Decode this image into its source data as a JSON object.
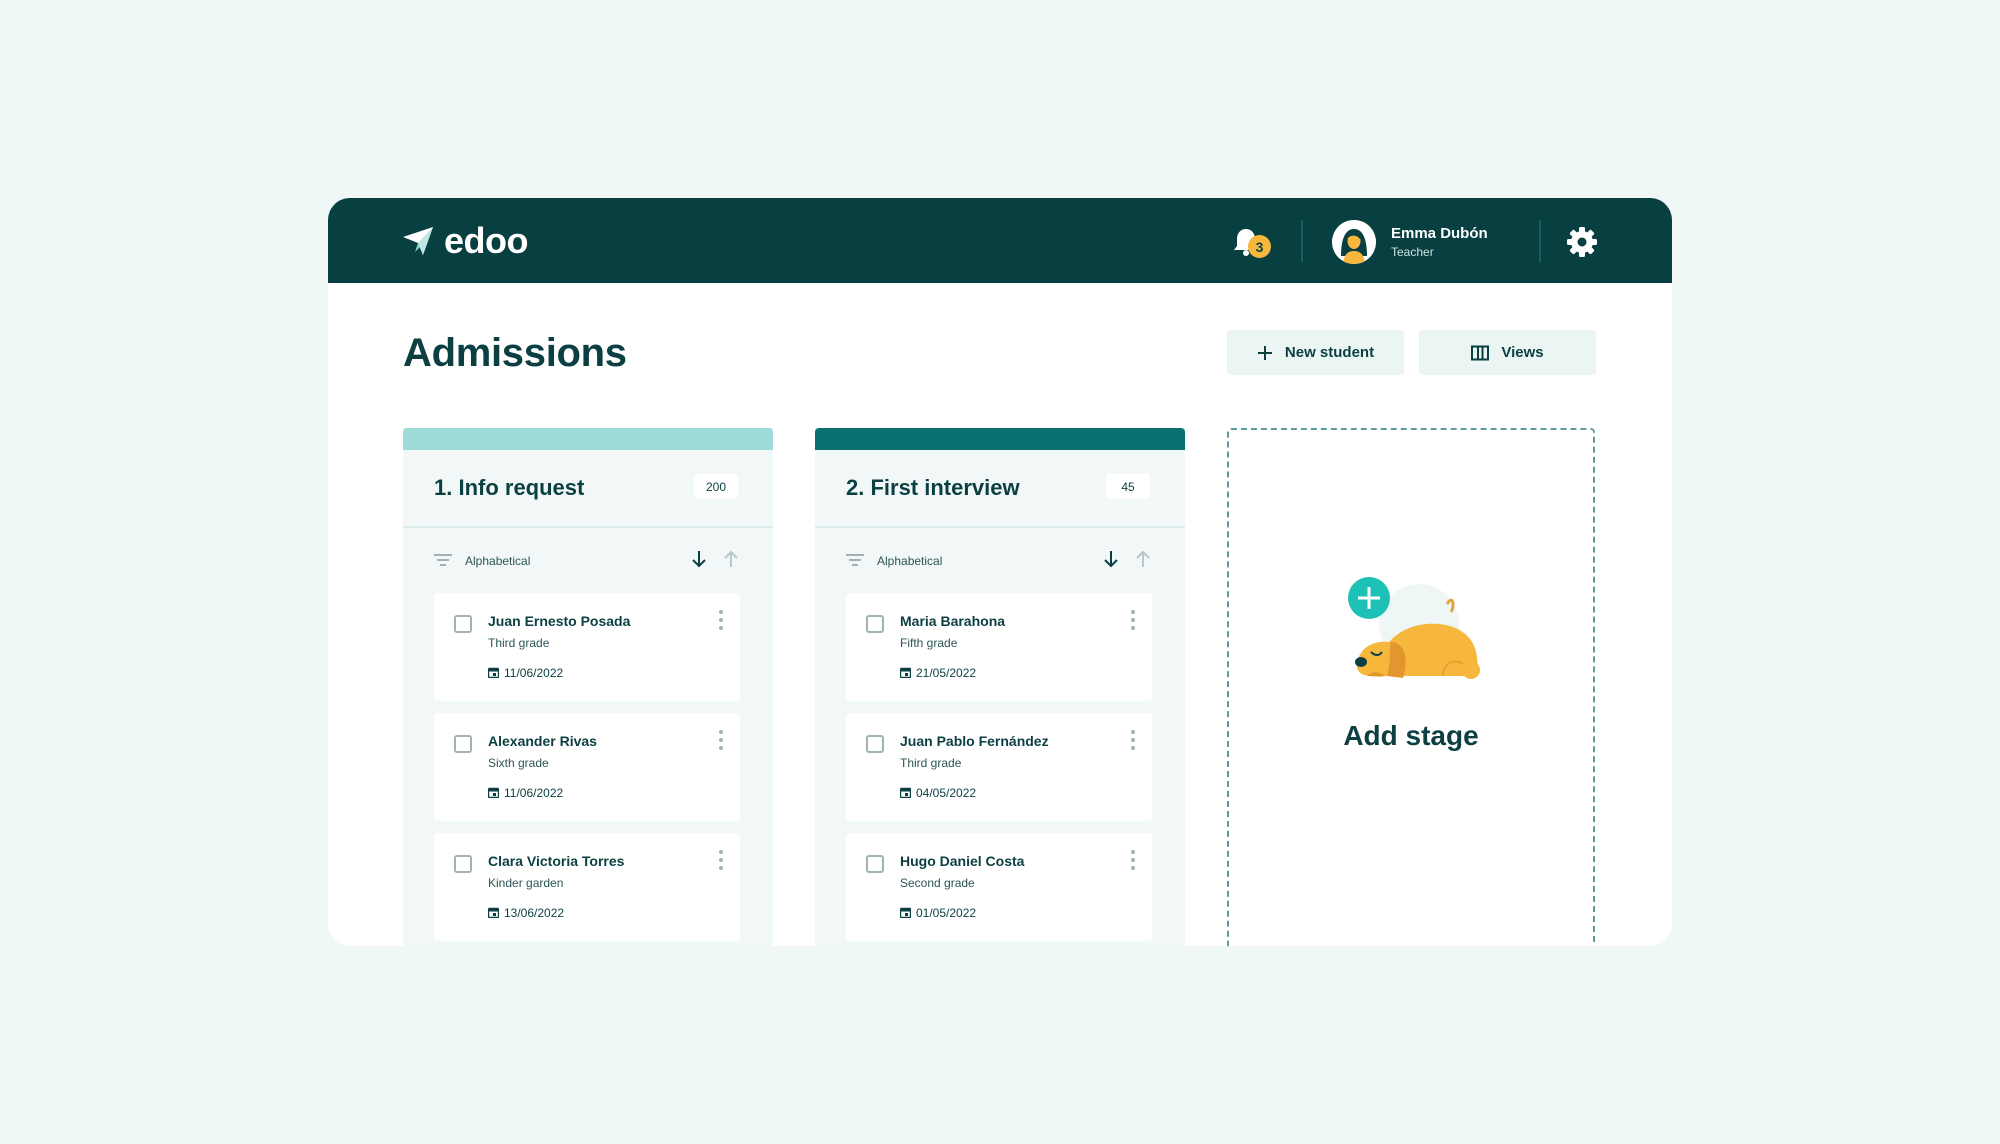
{
  "app": {
    "name": "edoo"
  },
  "header": {
    "notification_count": "3",
    "user": {
      "name": "Emma Dubón",
      "role": "Teacher"
    }
  },
  "page": {
    "title": "Admissions",
    "actions": {
      "new_student": "New student",
      "views": "Views"
    }
  },
  "columns": [
    {
      "title": "1. Info request",
      "count": "200",
      "color": "#9ddcd8",
      "sort_label": "Alphabetical",
      "cards": [
        {
          "name": "Juan Ernesto Posada",
          "grade": "Third grade",
          "date": "11/06/2022"
        },
        {
          "name": "Alexander Rivas",
          "grade": "Sixth grade",
          "date": "11/06/2022"
        },
        {
          "name": "Clara Victoria Torres",
          "grade": "Kinder garden",
          "date": "13/06/2022"
        }
      ]
    },
    {
      "title": "2. First interview",
      "count": "45",
      "color": "#0b7070",
      "sort_label": "Alphabetical",
      "cards": [
        {
          "name": "Maria Barahona",
          "grade": "Fifth grade",
          "date": "21/05/2022"
        },
        {
          "name": "Juan Pablo Fernández",
          "grade": "Third grade",
          "date": "04/05/2022"
        },
        {
          "name": "Hugo Daniel Costa",
          "grade": "Second grade",
          "date": "01/05/2022"
        }
      ]
    }
  ],
  "add_stage": {
    "label": "Add stage"
  },
  "colors": {
    "header_bg": "#083f40",
    "accent": "#1ec1b6",
    "badge": "#f6b73c",
    "page_bg": "#eff8f7"
  }
}
